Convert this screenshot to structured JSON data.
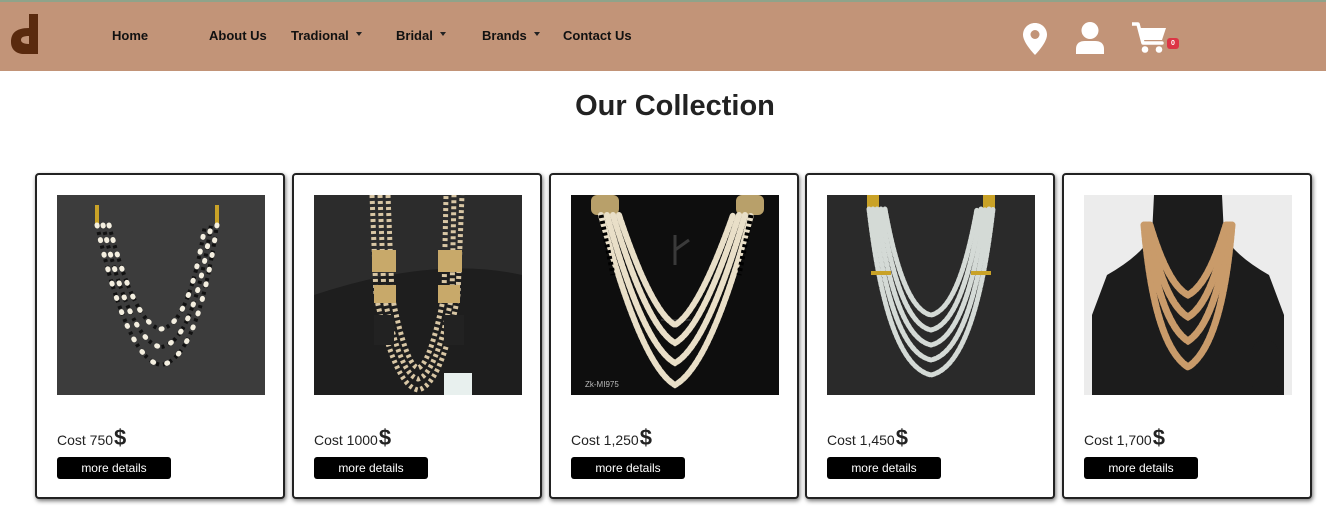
{
  "nav": {
    "logo_icon": "brand-logo-icon",
    "items": [
      {
        "label": "Home",
        "dropdown": false
      },
      {
        "label": "About Us",
        "dropdown": false
      },
      {
        "label": "Tradional",
        "dropdown": true
      },
      {
        "label": "Bridal",
        "dropdown": true
      },
      {
        "label": "Brands",
        "dropdown": true
      },
      {
        "label": "Contact Us",
        "dropdown": false
      }
    ],
    "icons": [
      "location-icon",
      "user-icon",
      "cart-icon"
    ],
    "cart_count": "0",
    "bar_color": "#c29478"
  },
  "page": {
    "title": "Our Collection"
  },
  "products": [
    {
      "cost_label": "Cost 750",
      "currency": "$",
      "button": "more details",
      "image_note": ""
    },
    {
      "cost_label": "Cost 1000",
      "currency": "$",
      "button": "more details",
      "image_note": ""
    },
    {
      "cost_label": "Cost 1,250",
      "currency": "$",
      "button": "more details",
      "image_note": "Zk-MI975"
    },
    {
      "cost_label": "Cost 1,450",
      "currency": "$",
      "button": "more details",
      "image_note": ""
    },
    {
      "cost_label": "Cost 1,700",
      "currency": "$",
      "button": "more details",
      "image_note": ""
    }
  ]
}
